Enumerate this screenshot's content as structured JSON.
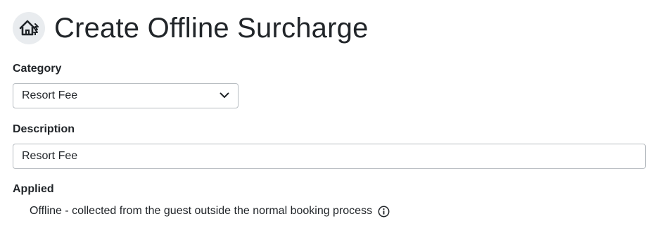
{
  "page": {
    "title": "Create Offline Surcharge",
    "icon": "house-surcharge-icon"
  },
  "form": {
    "category": {
      "label": "Category",
      "selected": "Resort Fee",
      "icon": "chevron-down-icon"
    },
    "description": {
      "label": "Description",
      "value": "Resort Fee"
    },
    "applied": {
      "label": "Applied",
      "text": "Offline - collected from the guest outside the normal booking process",
      "icon": "info-icon"
    }
  },
  "colors": {
    "text": "#212529",
    "border": "#b7bcc1",
    "icon_bg": "#e9ecef"
  }
}
